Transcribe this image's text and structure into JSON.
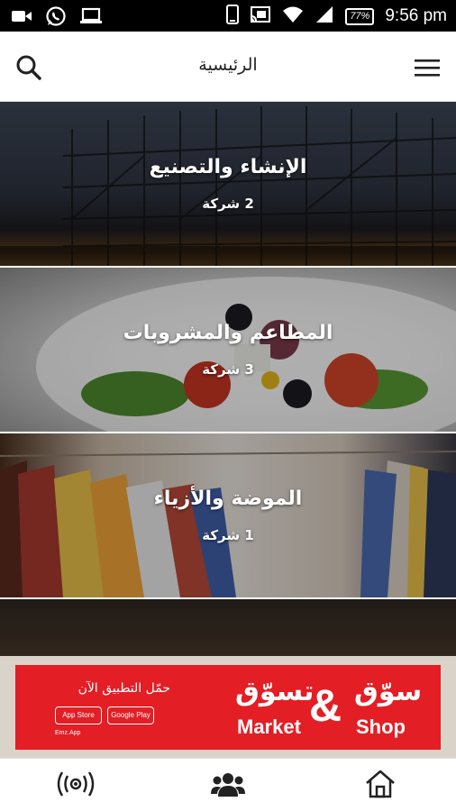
{
  "status_bar": {
    "time": "9:56 pm",
    "battery": "77%",
    "icons": [
      "video-icon",
      "whatsapp-icon",
      "laptop-icon",
      "phone-icon",
      "cast-icon",
      "wifi-icon",
      "signal-icon",
      "battery-icon"
    ]
  },
  "header": {
    "title": "الرئيسية",
    "icons": [
      "search-icon",
      "menu-icon"
    ]
  },
  "categories": [
    {
      "name": "الإنشاء والتصنيع",
      "count": "2 شركة"
    },
    {
      "name": "المطاعم والمشروبات",
      "count": "3 شركة"
    },
    {
      "name": "الموضة والأزياء",
      "count": "1 شركة"
    },
    {
      "name": "",
      "count": ""
    }
  ],
  "ad": {
    "cta": "حمّل التطبيق الآن",
    "app_store": "App Store",
    "google_play": "Google Play",
    "social": "Emz.App",
    "brand_ar_left": "تسوّق",
    "brand_ar_right": "سوّق",
    "ampersand": "&",
    "brand_en_left": "Market",
    "brand_en_right": "Shop",
    "color": "#e31e25"
  },
  "bottom_nav": {
    "icons": [
      "broadcast-icon",
      "users-icon",
      "home-icon"
    ]
  }
}
